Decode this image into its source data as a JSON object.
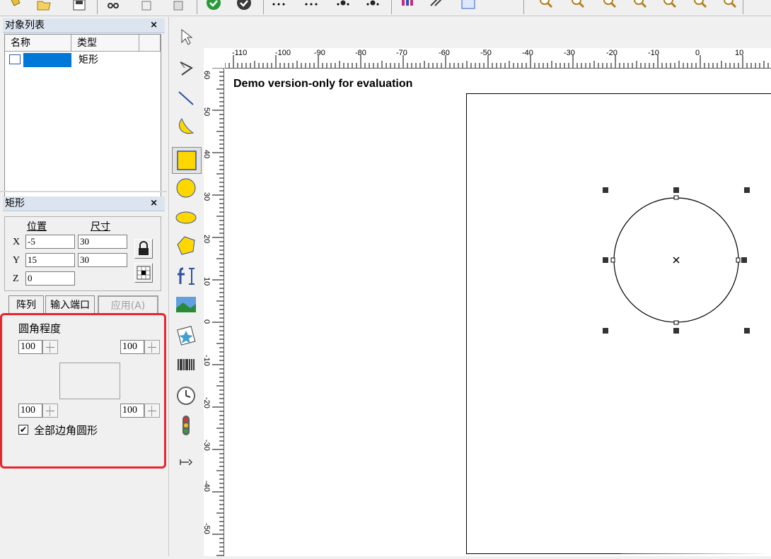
{
  "object_list": {
    "title": "对象列表",
    "close": "×",
    "columns": [
      "名称",
      "类型"
    ],
    "rows": [
      {
        "name": "",
        "type": "矩形"
      }
    ]
  },
  "properties": {
    "title": "矩形",
    "close": "×",
    "position_label": "位置",
    "size_label": "尺寸",
    "x_label": "X",
    "y_label": "Y",
    "z_label": "Z",
    "x_pos": "-5",
    "y_pos": "15",
    "z_pos": "0",
    "width": "30",
    "height": "30",
    "tabs": {
      "array": "阵列",
      "input_port": "输入端口",
      "apply": "应用(A)"
    },
    "corner_rounding_label": "圆角程度",
    "corner_tl": "100",
    "corner_tr": "100",
    "corner_bl": "100",
    "corner_br": "100",
    "all_corners_label": "全部边角圆形",
    "all_corners_checked": true
  },
  "canvas": {
    "watermark_text": "Demo version-only for evaluation",
    "h_ticks": [
      "-110",
      "-100",
      "-90",
      "-80",
      "-70",
      "-60",
      "-50",
      "-40",
      "-30",
      "-20",
      "-10",
      "0",
      "10"
    ],
    "v_ticks": [
      "60",
      "50",
      "40",
      "30",
      "20",
      "10",
      "0",
      "-10",
      "-20",
      "-30",
      "-40",
      "-50"
    ]
  },
  "colors": {
    "highlight_border": "#e8262e",
    "selection_blue": "#0078d7",
    "tool_yellow": "#ffd700"
  },
  "icons": [
    "new-icon",
    "open-icon",
    "save-icon",
    "cut-icon",
    "copy-icon",
    "paste-icon",
    "green-circle-icon",
    "dark-circle-icon",
    "zoom-icon"
  ]
}
